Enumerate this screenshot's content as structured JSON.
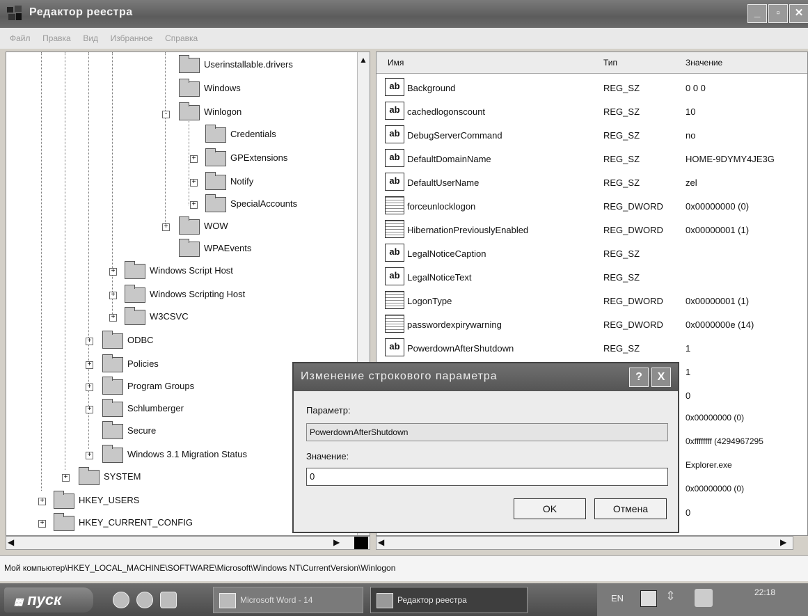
{
  "window": {
    "title": "Редактор реестра",
    "icon": "registry-editor-icon",
    "controls": [
      "minimize-icon",
      "maximize-icon",
      "close-icon"
    ]
  },
  "menu": [
    "Файл",
    "Правка",
    "Вид",
    "Избранное",
    "Справка"
  ],
  "tree": {
    "nodes": [
      {
        "label": "Userinstallable.drivers",
        "level": 5,
        "expander": ""
      },
      {
        "label": "Windows",
        "level": 5,
        "expander": ""
      },
      {
        "label": "Winlogon",
        "level": 5,
        "expander": "-"
      },
      {
        "label": "Credentials",
        "level": 6,
        "expander": ""
      },
      {
        "label": "GPExtensions",
        "level": 6,
        "expander": "+"
      },
      {
        "label": "Notify",
        "level": 6,
        "expander": "+"
      },
      {
        "label": "SpecialAccounts",
        "level": 6,
        "expander": "+"
      },
      {
        "label": "WOW",
        "level": 5,
        "expander": "+"
      },
      {
        "label": "WPAEvents",
        "level": 5,
        "expander": ""
      },
      {
        "label": "Windows Script Host",
        "level": 4,
        "expander": "+"
      },
      {
        "label": "Windows Scripting Host",
        "level": 4,
        "expander": "+"
      },
      {
        "label": "W3CSVC",
        "level": 4,
        "expander": "+"
      },
      {
        "label": "ODBC",
        "level": 3,
        "expander": "+"
      },
      {
        "label": "Policies",
        "level": 3,
        "expander": "+"
      },
      {
        "label": "Program Groups",
        "level": 3,
        "expander": "+"
      },
      {
        "label": "Schlumberger",
        "level": 3,
        "expander": "+"
      },
      {
        "label": "Secure",
        "level": 3,
        "expander": ""
      },
      {
        "label": "Windows 3.1 Migration Status",
        "level": 3,
        "expander": "+"
      },
      {
        "label": "SYSTEM",
        "level": 2,
        "expander": "+"
      },
      {
        "label": "HKEY_USERS",
        "level": 1,
        "expander": "+"
      },
      {
        "label": "HKEY_CURRENT_CONFIG",
        "level": 1,
        "expander": "+"
      }
    ]
  },
  "list": {
    "headers": {
      "name": "Имя",
      "type": "Тип",
      "value": "Значение"
    },
    "rows": [
      {
        "name": "Background",
        "type": "REG_SZ",
        "value": "0 0 0",
        "icon": "ab"
      },
      {
        "name": "cachedlogonscount",
        "type": "REG_SZ",
        "value": "10",
        "icon": "ab"
      },
      {
        "name": "DebugServerCommand",
        "type": "REG_SZ",
        "value": "no",
        "icon": "ab"
      },
      {
        "name": "DefaultDomainName",
        "type": "REG_SZ",
        "value": "HOME-9DYMY4JE3G",
        "icon": "ab"
      },
      {
        "name": "DefaultUserName",
        "type": "REG_SZ",
        "value": "zel",
        "icon": "ab"
      },
      {
        "name": "forceunlocklogon",
        "type": "REG_DWORD",
        "value": "0x00000000 (0)",
        "icon": "bin"
      },
      {
        "name": "HibernationPreviouslyEnabled",
        "type": "REG_DWORD",
        "value": "0x00000001 (1)",
        "icon": "bin"
      },
      {
        "name": "LegalNoticeCaption",
        "type": "REG_SZ",
        "value": "",
        "icon": "ab"
      },
      {
        "name": "LegalNoticeText",
        "type": "REG_SZ",
        "value": "",
        "icon": "ab"
      },
      {
        "name": "LogonType",
        "type": "REG_DWORD",
        "value": "0x00000001 (1)",
        "icon": "bin"
      },
      {
        "name": "passwordexpirywarning",
        "type": "REG_DWORD",
        "value": "0x0000000e (14)",
        "icon": "bin"
      },
      {
        "name": "PowerdownAfterShutdown",
        "type": "REG_SZ",
        "value": "1",
        "icon": "ab"
      }
    ],
    "hidden_values": [
      "1",
      "0",
      "0x00000000 (0)",
      "0xffffffff (4294967295",
      "Explorer.exe",
      "0x00000000 (0)",
      "0"
    ]
  },
  "dialog": {
    "title": "Изменение строкового параметра",
    "param_label": "Параметр:",
    "param_value": "PowerdownAfterShutdown",
    "value_label": "Значение:",
    "value_input": "0",
    "ok": "OK",
    "cancel": "Отмена",
    "help_icon": "?",
    "close_icon": "X"
  },
  "statusbar": {
    "path": "Мой компьютер\\HKEY_LOCAL_MACHINE\\SOFTWARE\\Microsoft\\Windows NT\\CurrentVersion\\Winlogon"
  },
  "taskbar": {
    "start": "пуск",
    "tasks": [
      {
        "label": "Microsoft Word - 14",
        "icon": "word-icon"
      },
      {
        "label": "Редактор реестра",
        "icon": "registry-editor-icon"
      }
    ],
    "lang": "EN",
    "clock": "22:18"
  }
}
